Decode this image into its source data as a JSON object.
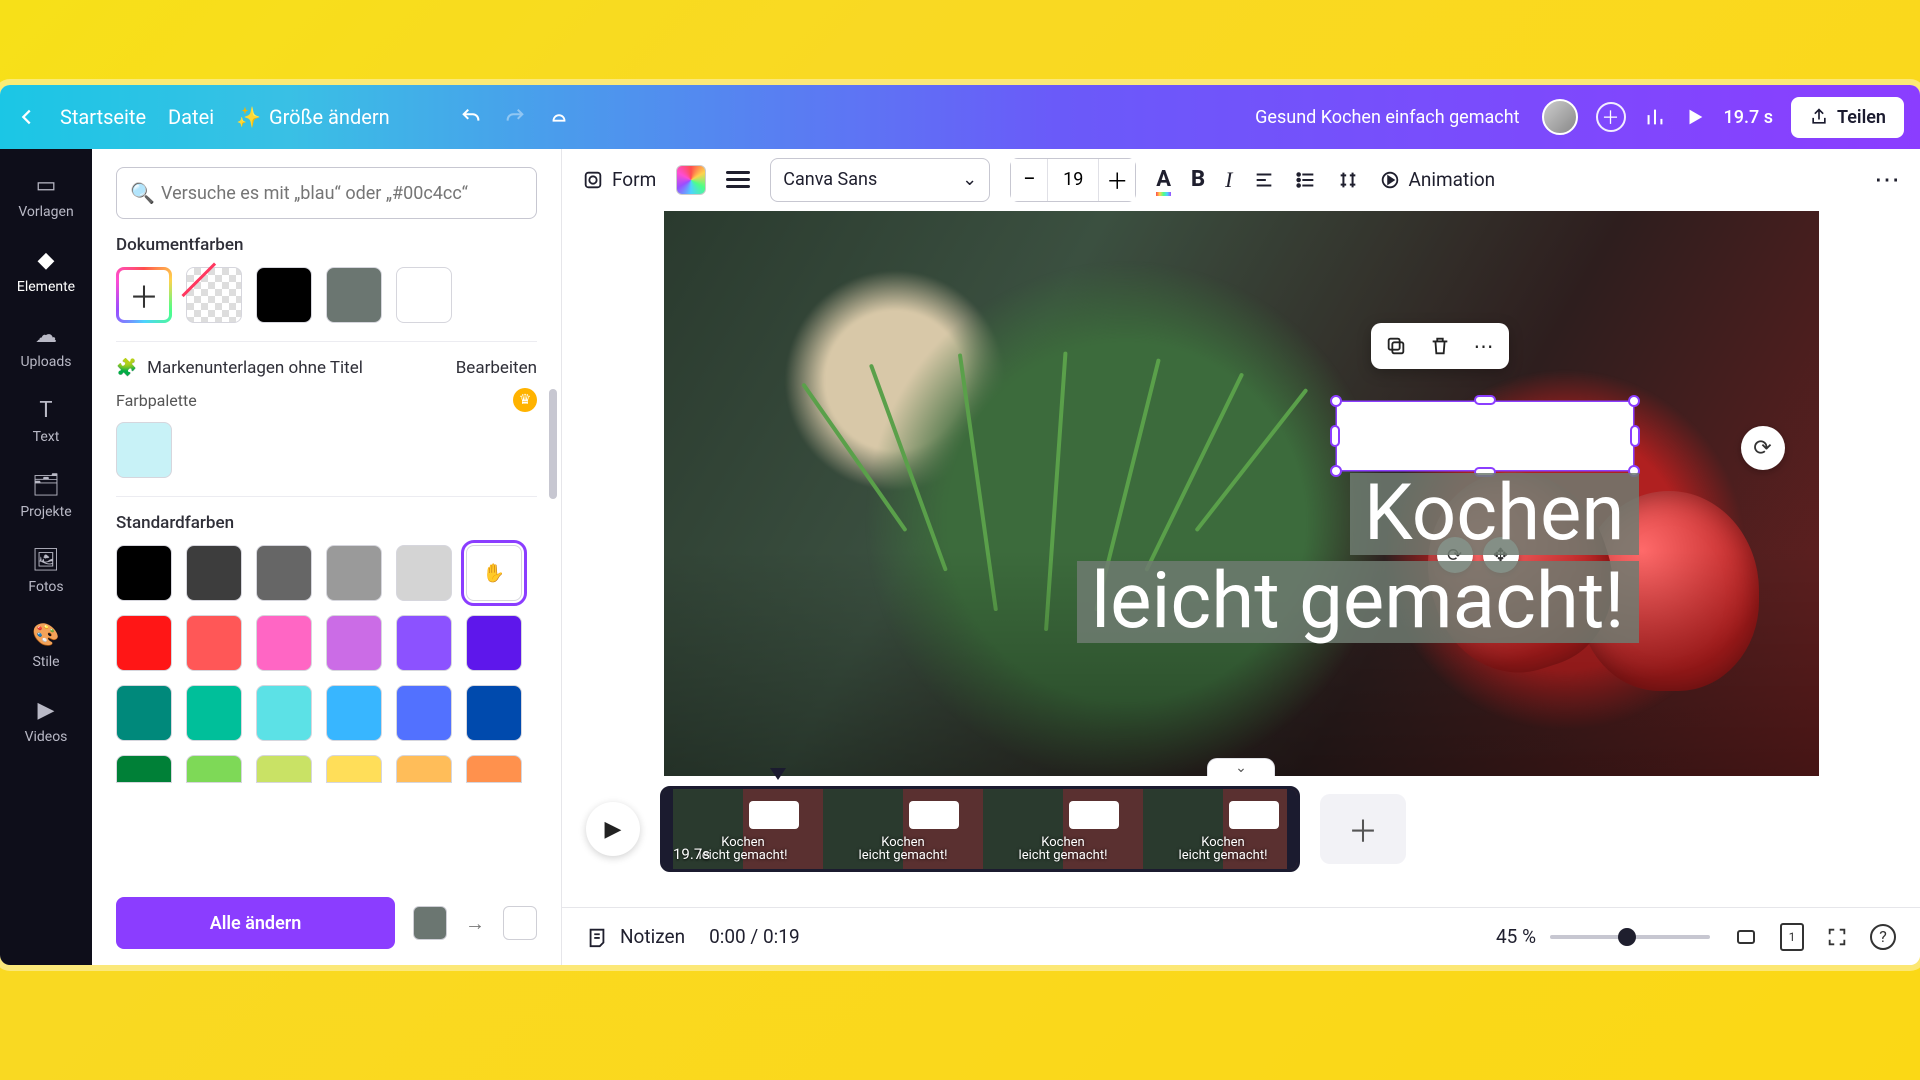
{
  "topbar": {
    "home": "Startseite",
    "file": "Datei",
    "resize": "Größe ändern",
    "doc_title": "Gesund Kochen einfach gemacht",
    "duration": "19.7 s",
    "share": "Teilen"
  },
  "rail": [
    {
      "label": "Vorlagen"
    },
    {
      "label": "Elemente"
    },
    {
      "label": "Uploads"
    },
    {
      "label": "Text"
    },
    {
      "label": "Projekte"
    },
    {
      "label": "Fotos"
    },
    {
      "label": "Stile"
    },
    {
      "label": "Videos"
    }
  ],
  "color_panel": {
    "search_placeholder": "Versuche es mit „blau“ oder „#00c4cc“",
    "section_document": "Dokumentfarben",
    "document_colors": [
      "add",
      "transparent",
      "#000000",
      "#6b7671",
      "#ffffff"
    ],
    "brand_kit_label": "Markenunterlagen ohne Titel",
    "brand_edit": "Bearbeiten",
    "palette_label": "Farbpalette",
    "palette_colors": [
      "#c8f2f7"
    ],
    "section_default": "Standardfarben",
    "default_colors": [
      [
        "#000000",
        "#3d3d3d",
        "#666666",
        "#9a9a9a",
        "#d4d4d4",
        "#ffffff"
      ],
      [
        "#ff1616",
        "#ff5757",
        "#ff66c4",
        "#cb6ce6",
        "#8c52ff",
        "#5e17eb"
      ],
      [
        "#00897b",
        "#00bf9a",
        "#5ce1e6",
        "#38b6ff",
        "#5271ff",
        "#004aad"
      ],
      [
        "#008037",
        "#7ed957",
        "#c9e265",
        "#ffde59",
        "#ffbd59",
        "#ff914d"
      ]
    ],
    "selected_default": "#ffffff",
    "change_all": "Alle ändern",
    "from_color": "#6b7671",
    "to_color": "#ffffff"
  },
  "toolbelt": {
    "form": "Form",
    "font": "Canva Sans",
    "font_size": "19",
    "animation": "Animation"
  },
  "canvas": {
    "text_line1": "Kochen",
    "text_line2": "leicht gemacht!"
  },
  "timeline": {
    "clip_duration": "19.7s",
    "thumb_caption_l1": "Kochen",
    "thumb_caption_l2": "leicht gemacht!"
  },
  "bottombar": {
    "notes": "Notizen",
    "timecode": "0:00 / 0:19",
    "zoom": "45 %",
    "page_indicator": "1"
  }
}
